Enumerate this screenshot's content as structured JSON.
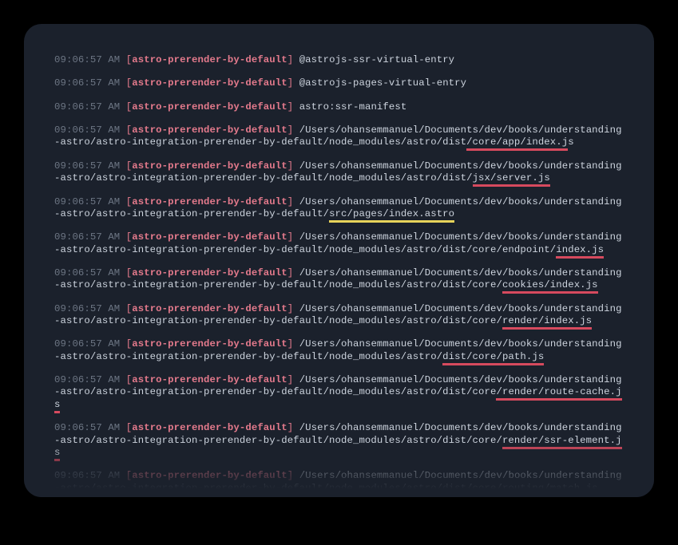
{
  "timestamp": "09:06:57 AM",
  "tag": "astro-prerender-by-default",
  "colors": {
    "bg_outer": "#000000",
    "bg_panel": "#1b212c",
    "text": "#cdd4de",
    "dim": "#6d7684",
    "accent": "#e47a8c",
    "underline_red": "#d64a5e",
    "underline_yellow": "#e7d35a"
  },
  "entries": [
    {
      "message": "@astrojs-ssr-virtual-entry",
      "underline": null,
      "underline_text": ""
    },
    {
      "message": "@astrojs-pages-virtual-entry",
      "underline": null,
      "underline_text": ""
    },
    {
      "message": "astro:ssr-manifest",
      "underline": null,
      "underline_text": ""
    },
    {
      "message": "/Users/ohansemmanuel/Documents/dev/books/understanding-astro/astro-integration-prerender-by-default/node_modules/astro/dist",
      "underline": "red",
      "underline_text": "/core/app/index.j",
      "tail": "s"
    },
    {
      "message": "/Users/ohansemmanuel/Documents/dev/books/understanding-astro/astro-integration-prerender-by-default/node_modules/astro/dist/",
      "underline": "red",
      "underline_text": "jsx/server.js",
      "tail": ""
    },
    {
      "message": "/Users/ohansemmanuel/Documents/dev/books/understanding-astro/astro-integration-prerender-by-default/",
      "underline": "yellow",
      "underline_text": "src/pages/index.astro",
      "tail": ""
    },
    {
      "message": "/Users/ohansemmanuel/Documents/dev/books/understanding-astro/astro-integration-prerender-by-default/node_modules/astro/dist/core/endpoint/",
      "underline": "red",
      "underline_text": "index.js",
      "tail": ""
    },
    {
      "message": "/Users/ohansemmanuel/Documents/dev/books/understanding-astro/astro-integration-prerender-by-default/node_modules/astro/dist/core/",
      "underline": "red",
      "underline_text": "cookies/index.js",
      "tail": ""
    },
    {
      "message": "/Users/ohansemmanuel/Documents/dev/books/understanding-astro/astro-integration-prerender-by-default/node_modules/astro/dist/core/",
      "underline": "red",
      "underline_text": "render/index.js",
      "tail": ""
    },
    {
      "message": "/Users/ohansemmanuel/Documents/dev/books/understanding-astro/astro-integration-prerender-by-default/node_modules/astro/",
      "underline": "red",
      "underline_text": "dist/core/path.js",
      "tail": ""
    },
    {
      "message": "/Users/ohansemmanuel/Documents/dev/books/understanding-astro/astro-integration-prerender-by-default/node_modules/astro/dist/core",
      "underline": "red",
      "underline_text": "/render/route-cache.js",
      "tail": ""
    },
    {
      "message": "/Users/ohansemmanuel/Documents/dev/books/understanding-astro/astro-integration-prerender-by-default/node_modules/astro/dist/core/",
      "underline": "red",
      "underline_text": "render/ssr-element.js",
      "tail": ""
    },
    {
      "message": "/Users/ohansemmanuel/Documents/dev/books/understanding-astro/astro-integration-prerender-by-default/node_modules/astro/dist/core/routing/match.js",
      "underline": null,
      "underline_text": ""
    }
  ]
}
